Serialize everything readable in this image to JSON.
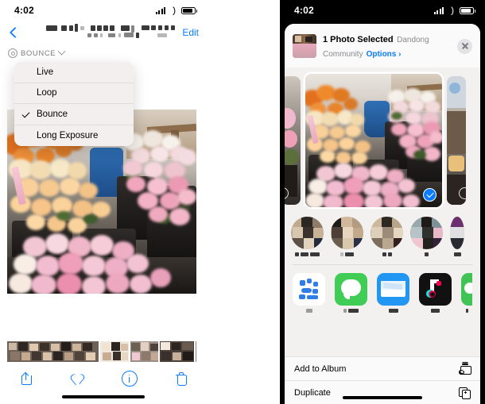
{
  "left_phone": {
    "status_bar": {
      "time": "4:02",
      "signal_icon": "cellular-bars-icon",
      "wifi_icon": "wifi-icon",
      "battery_icon": "battery-icon"
    },
    "nav": {
      "back_icon": "back-chevron-icon",
      "title": "",
      "edit_label": "Edit"
    },
    "live_mode": {
      "icon": "live-photo-icon",
      "label": "BOUNCE",
      "chevron_icon": "chevron-down-icon"
    },
    "dropdown": {
      "items": [
        {
          "label": "Live",
          "checked": false
        },
        {
          "label": "Loop",
          "checked": false
        },
        {
          "label": "Bounce",
          "checked": true
        },
        {
          "label": "Long Exposure",
          "checked": false
        }
      ]
    },
    "toolbar": {
      "share_icon": "share-icon",
      "favorite_icon": "heart-icon",
      "info_icon": "info-icon",
      "delete_icon": "trash-icon"
    }
  },
  "right_phone": {
    "status_bar": {
      "time": "4:02",
      "signal_icon": "cellular-bars-icon",
      "wifi_icon": "wifi-icon",
      "battery_icon": "battery-icon"
    },
    "share_sheet": {
      "title": "1 Photo Selected",
      "subtitle": "Dandong Community",
      "options_label": "Options",
      "options_chevron": "chevron-right-icon",
      "close_icon": "close-icon",
      "selected_check_icon": "checkmark-circle-icon",
      "contacts": [
        {
          "name_blurred": true
        },
        {
          "name_blurred": true
        },
        {
          "name_blurred": true
        },
        {
          "name_blurred": true
        },
        {
          "name_blurred": true
        }
      ],
      "apps": [
        {
          "icon": "airdrop-icon",
          "color": "#2f7ee8",
          "bg": "#ffffff"
        },
        {
          "icon": "messages-icon",
          "color": "#ffffff",
          "bg": "#41cc55"
        },
        {
          "icon": "mail-icon",
          "color": "#ffffff",
          "bg": "#2196f3"
        },
        {
          "icon": "tiktok-icon",
          "color": "#ff0050",
          "bg": "#111111"
        },
        {
          "icon": "wechat-icon",
          "color": "#ffffff",
          "bg": "#42c355"
        }
      ],
      "actions": [
        {
          "label": "Add to Album",
          "icon": "add-to-album-icon"
        },
        {
          "label": "Duplicate",
          "icon": "duplicate-icon"
        }
      ]
    }
  },
  "colors": {
    "accent_blue": "#0a7cff",
    "sheet_bg": "#f3f1f0",
    "menu_bg": "#f2efee"
  }
}
